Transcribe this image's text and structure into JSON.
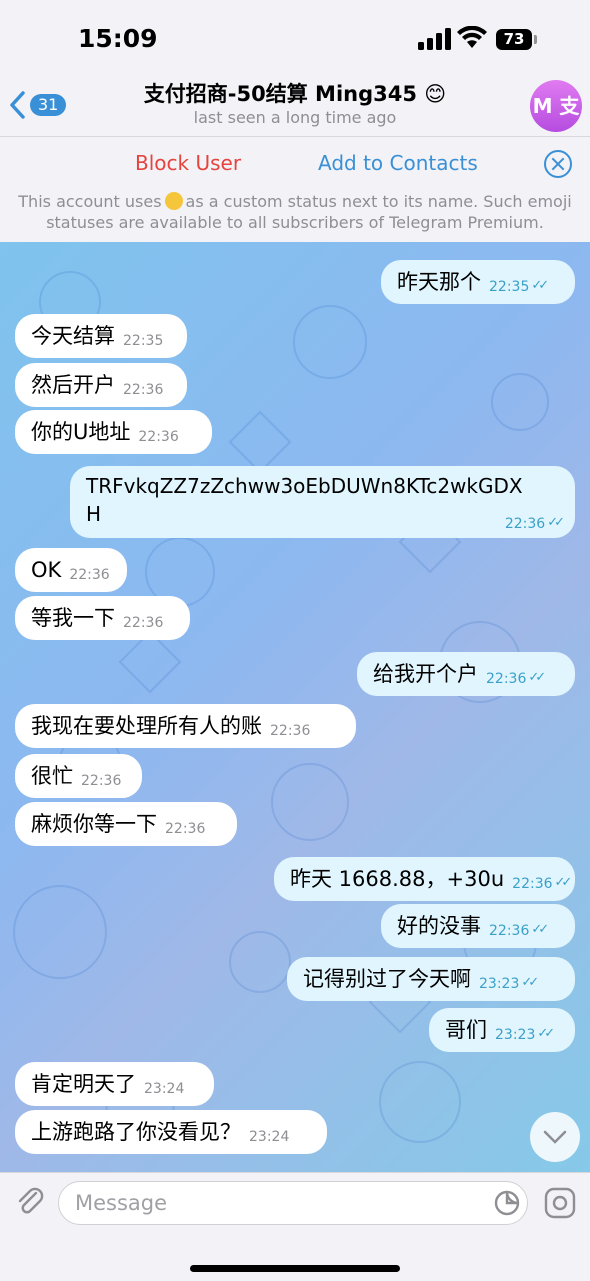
{
  "status": {
    "time": "15:09",
    "battery": "73"
  },
  "header": {
    "back_count": "31",
    "title": "支付招商-50结算 Ming345 😊",
    "subtitle": "last seen a long time ago",
    "avatar_initials": "M 支"
  },
  "action_bar": {
    "block_label": "Block User",
    "add_label": "Add to Contacts",
    "notice_pre": "This account uses",
    "notice_post": "as a custom status next to its name. Such emoji statuses are available to all subscribers of Telegram Premium."
  },
  "messages": [
    {
      "dir": "out",
      "text": "昨天那个",
      "time": "22:35"
    },
    {
      "dir": "in",
      "text": "今天结算",
      "time": "22:35"
    },
    {
      "dir": "in",
      "text": "然后开户",
      "time": "22:36"
    },
    {
      "dir": "in",
      "text": "你的U地址",
      "time": "22:36"
    },
    {
      "dir": "out",
      "text": "TRFvkqZZ7zZchww3oEbDUWn8KTc2wkGDX",
      "text2": "H",
      "time": "22:36"
    },
    {
      "dir": "in",
      "text": "OK",
      "time": "22:36"
    },
    {
      "dir": "in",
      "text": "等我一下",
      "time": "22:36"
    },
    {
      "dir": "out",
      "text": "给我开个户",
      "time": "22:36"
    },
    {
      "dir": "in",
      "text": "我现在要处理所有人的账",
      "time": "22:36"
    },
    {
      "dir": "in",
      "text": "很忙",
      "time": "22:36"
    },
    {
      "dir": "in",
      "text": "麻烦你等一下",
      "time": "22:36"
    },
    {
      "dir": "out",
      "text": "昨天 1668.88，+30u",
      "time": "22:36"
    },
    {
      "dir": "out",
      "text": "好的没事",
      "time": "22:36"
    },
    {
      "dir": "out",
      "text": "记得别过了今天啊",
      "time": "23:23"
    },
    {
      "dir": "out",
      "text": "哥们",
      "time": "23:23"
    },
    {
      "dir": "in",
      "text": "肯定明天了",
      "time": "23:24"
    },
    {
      "dir": "in",
      "text": "上游跑路了你没看见？",
      "time": "23:24"
    }
  ],
  "input": {
    "placeholder": "Message"
  },
  "colors": {
    "accent": "#3a90d6",
    "danger": "#e5443f",
    "outgoing_bubble": "#e1f5fe",
    "incoming_bubble": "#ffffff"
  }
}
